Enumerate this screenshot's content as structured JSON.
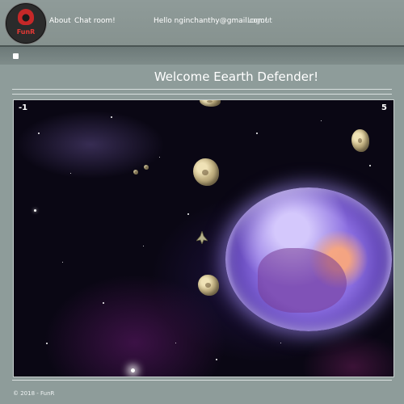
{
  "header": {
    "logo_text": "FunR",
    "nav": [
      "About",
      "Chat room!"
    ],
    "greeting": "Hello nginchanthy@gmail.com!",
    "logout": "Logout"
  },
  "page": {
    "title": "Welcome Eearth Defender!"
  },
  "game": {
    "score_left": "-1",
    "score_right": "5"
  },
  "footer": {
    "text": "© 2018 - FunR"
  },
  "colors": {
    "background": "#8e9c9a",
    "planet": "#8a6de0",
    "logo_red": "#c62828"
  }
}
